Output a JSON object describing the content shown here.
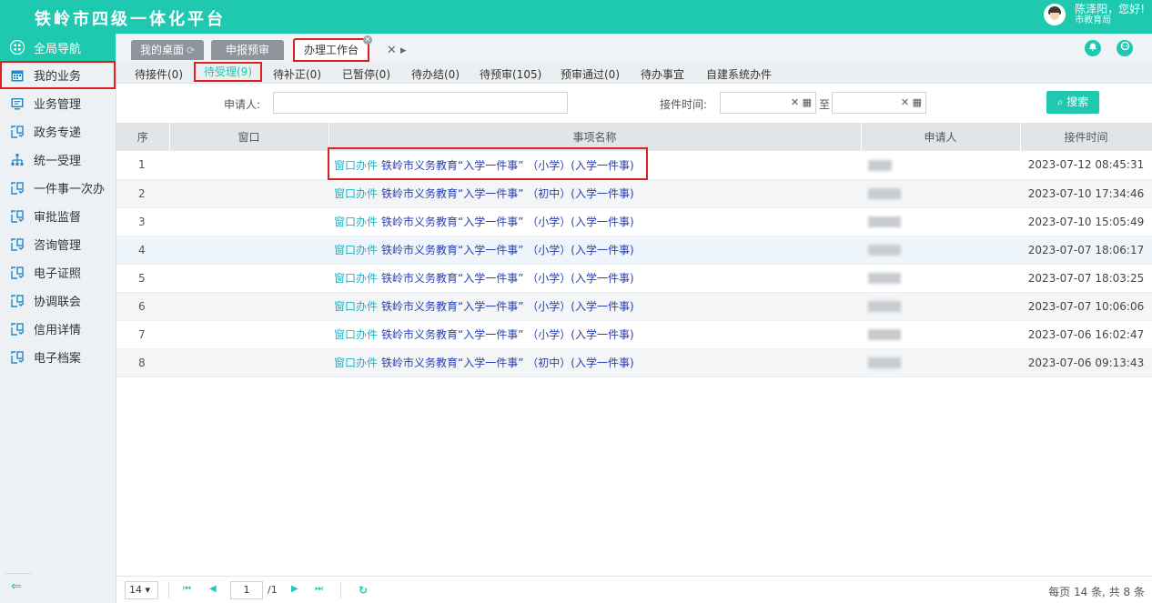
{
  "header": {
    "title": "铁岭市四级一体化平台",
    "user_name": "陈泽阳，您好!",
    "user_org": "市教育局"
  },
  "sidebar": {
    "items": [
      {
        "label": "全局导航",
        "icon": "grid-icon"
      },
      {
        "label": "我的业务",
        "icon": "calendar-icon"
      },
      {
        "label": "业务管理",
        "icon": "monitor-icon"
      },
      {
        "label": "政务专递",
        "icon": "window-icon"
      },
      {
        "label": "统一受理",
        "icon": "org-icon"
      },
      {
        "label": "一件事一次办",
        "icon": "window-icon"
      },
      {
        "label": "审批监督",
        "icon": "window-icon"
      },
      {
        "label": "咨询管理",
        "icon": "window-icon"
      },
      {
        "label": "电子证照",
        "icon": "window-icon"
      },
      {
        "label": "协调联会",
        "icon": "window-icon"
      },
      {
        "label": "信用详情",
        "icon": "window-icon"
      },
      {
        "label": "电子档案",
        "icon": "window-icon"
      }
    ],
    "collapse": "⇐"
  },
  "tabs": {
    "t1": "我的桌面",
    "t2": "申报预审",
    "t3": "办理工作台",
    "extra": "✕ ▸"
  },
  "subtabs": [
    "待接件(0)",
    "待受理(9)",
    "待补正(0)",
    "已暂停(0)",
    "待办结(0)",
    "待预审(105)",
    "预审通过(0)",
    "待办事宜",
    "自建系统办件"
  ],
  "search": {
    "applicant_label": "申请人:",
    "time_label": "接件时间:",
    "to": "至",
    "button": "搜索"
  },
  "table": {
    "headers": [
      "序",
      "窗口",
      "事项名称",
      "申请人",
      "接件时间"
    ],
    "rows": [
      {
        "no": "1",
        "type": "窗口办件",
        "item": "铁岭市义务教育“入学一件事” （小学）(入学一件事)",
        "time": "2023-07-12 08:45:31"
      },
      {
        "no": "2",
        "type": "窗口办件",
        "item": "铁岭市义务教育“入学一件事” （初中）(入学一件事)",
        "time": "2023-07-10 17:34:46"
      },
      {
        "no": "3",
        "type": "窗口办件",
        "item": "铁岭市义务教育“入学一件事” （小学）(入学一件事)",
        "time": "2023-07-10 15:05:49"
      },
      {
        "no": "4",
        "type": "窗口办件",
        "item": "铁岭市义务教育“入学一件事” （小学）(入学一件事)",
        "time": "2023-07-07 18:06:17"
      },
      {
        "no": "5",
        "type": "窗口办件",
        "item": "铁岭市义务教育“入学一件事” （小学）(入学一件事)",
        "time": "2023-07-07 18:03:25"
      },
      {
        "no": "6",
        "type": "窗口办件",
        "item": "铁岭市义务教育“入学一件事” （小学）(入学一件事)",
        "time": "2023-07-07 10:06:06"
      },
      {
        "no": "7",
        "type": "窗口办件",
        "item": "铁岭市义务教育“入学一件事” （小学）(入学一件事)",
        "time": "2023-07-06 16:02:47"
      },
      {
        "no": "8",
        "type": "窗口办件",
        "item": "铁岭市义务教育“入学一件事” （初中）(入学一件事)",
        "time": "2023-07-06 09:13:43"
      }
    ]
  },
  "pager": {
    "size": "14",
    "page": "1",
    "total_pages": "/1",
    "info": "每页 14 条, 共 8 条"
  },
  "colors": {
    "accent": "#1ec9b0",
    "highlight": "#e02020"
  }
}
